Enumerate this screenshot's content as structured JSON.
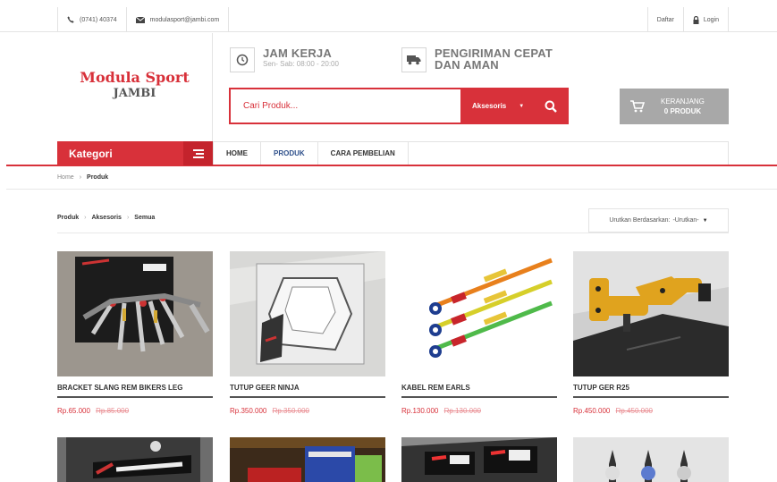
{
  "topbar": {
    "phone": "(0741) 40374",
    "email": "modulasport@jambi.com",
    "register": "Daftar",
    "login": "Login"
  },
  "logo": {
    "line1": "Modula Sport",
    "line2": "JAMBI"
  },
  "info": {
    "hours_title": "JAM KERJA",
    "hours_sub": "Sen- Sab: 08:00 - 20:00",
    "shipping_line1": "PENGIRIMAN CEPAT",
    "shipping_line2": "DAN AMAN"
  },
  "search": {
    "placeholder": "Cari Produk...",
    "category": "Aksesoris"
  },
  "cart": {
    "label": "KERANJANG",
    "count": "0 PRODUK"
  },
  "nav": {
    "kategori": "Kategori",
    "items": [
      "HOME",
      "PRODUK",
      "CARA PEMBELIAN"
    ]
  },
  "breadcrumb": [
    "Home",
    "Produk"
  ],
  "listing": {
    "path": [
      "Produk",
      "Aksesoris",
      "Semua"
    ],
    "sort_label": "Urutkan Berdasarkan:",
    "sort_value": "-Urutkan-"
  },
  "products": [
    {
      "title": "BRACKET SLANG REM BIKERS LEG",
      "price": "Rp.65.000",
      "old_price": "Rp.85.000"
    },
    {
      "title": "TUTUP GEER NINJA",
      "price": "Rp.350.000",
      "old_price": "Rp.350.000"
    },
    {
      "title": "KABEL REM EARLS",
      "price": "Rp.130.000",
      "old_price": "Rp.130.000"
    },
    {
      "title": "TUTUP GER R25",
      "price": "Rp.450.000",
      "old_price": "Rp.450.000"
    }
  ],
  "colors": {
    "accent": "#d8313a",
    "nav_active": "#2d4f8a",
    "cart_bg": "#a8a8a8"
  }
}
